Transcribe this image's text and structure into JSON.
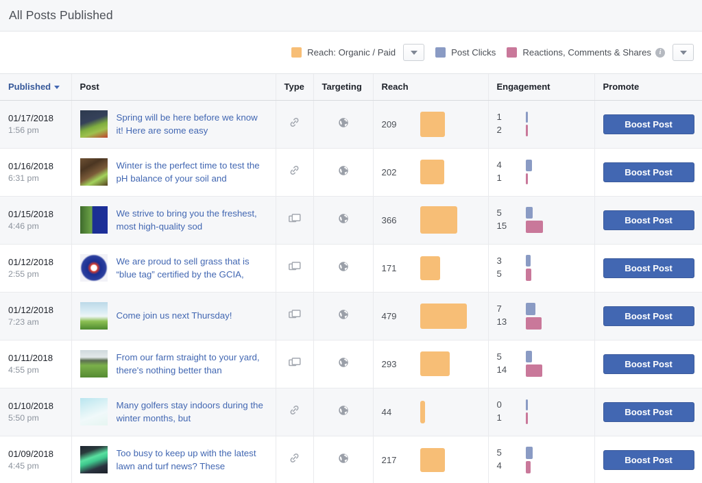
{
  "header": {
    "title": "All Posts Published"
  },
  "legend": {
    "items": [
      {
        "label": "Reach: Organic / Paid",
        "color": "#f7be76",
        "icon": "square-swatch"
      },
      {
        "label": "Post Clicks",
        "color": "#8a9bc4",
        "icon": "square-swatch"
      },
      {
        "label": "Reactions, Comments & Shares",
        "color": "#c9789a",
        "icon": "square-swatch"
      }
    ],
    "info_icon": "info-icon",
    "dropdown_icon": "chevron-down-icon",
    "dropdown_1_label": "",
    "dropdown_2_label": ""
  },
  "table": {
    "columns": [
      {
        "key": "published",
        "label": "Published",
        "sorted": true,
        "sort_dir": "desc"
      },
      {
        "key": "post",
        "label": "Post"
      },
      {
        "key": "type",
        "label": "Type"
      },
      {
        "key": "targeting",
        "label": "Targeting"
      },
      {
        "key": "reach",
        "label": "Reach"
      },
      {
        "key": "engagement",
        "label": "Engagement"
      },
      {
        "key": "promote",
        "label": "Promote"
      }
    ],
    "promote_button_label": "Boost Post",
    "rows": [
      {
        "date": "01/17/2018",
        "time": "1:56 pm",
        "text": "Spring will be here before we know it! Here are some easy",
        "type_icon": "link-icon",
        "targeting_icon": "globe-icon",
        "reach": 209,
        "reach_bar_w": 36,
        "reach_bar_h": 37,
        "clicks": 1,
        "reactions": 2,
        "clicks_bar_w": 3,
        "clicks_bar_h": 16,
        "react_bar_w": 3,
        "react_bar_h": 17,
        "thumb": "thumb-spring"
      },
      {
        "date": "01/16/2018",
        "time": "6:31 pm",
        "text": "Winter is the perfect time to test the pH balance of your soil and",
        "type_icon": "link-icon",
        "targeting_icon": "globe-icon",
        "reach": 202,
        "reach_bar_w": 35,
        "reach_bar_h": 36,
        "clicks": 4,
        "reactions": 1,
        "clicks_bar_w": 9,
        "clicks_bar_h": 17,
        "react_bar_w": 3,
        "react_bar_h": 16,
        "thumb": "thumb-soil"
      },
      {
        "date": "01/15/2018",
        "time": "4:46 pm",
        "text": "We strive to bring you the freshest, most high-quality sod",
        "type_icon": "photos-icon",
        "targeting_icon": "globe-icon",
        "reach": 366,
        "reach_bar_w": 54,
        "reach_bar_h": 40,
        "clicks": 5,
        "reactions": 15,
        "clicks_bar_w": 10,
        "clicks_bar_h": 17,
        "react_bar_w": 25,
        "react_bar_h": 18,
        "thumb": "thumb-sod"
      },
      {
        "date": "01/12/2018",
        "time": "2:55 pm",
        "text": "We are proud to sell grass that is “blue tag” certified by the GCIA,",
        "type_icon": "photos-icon",
        "targeting_icon": "globe-icon",
        "reach": 171,
        "reach_bar_w": 29,
        "reach_bar_h": 35,
        "clicks": 3,
        "reactions": 5,
        "clicks_bar_w": 7,
        "clicks_bar_h": 17,
        "react_bar_w": 8,
        "react_bar_h": 18,
        "thumb": "thumb-gcia"
      },
      {
        "date": "01/12/2018",
        "time": "7:23 am",
        "text": "Come join us next Thursday!",
        "type_icon": "photos-icon",
        "targeting_icon": "globe-icon",
        "reach": 479,
        "reach_bar_w": 68,
        "reach_bar_h": 37,
        "clicks": 7,
        "reactions": 13,
        "clicks_bar_w": 14,
        "clicks_bar_h": 18,
        "react_bar_w": 23,
        "react_bar_h": 18,
        "thumb": "thumb-event"
      },
      {
        "date": "01/11/2018",
        "time": "4:55 pm",
        "text": "From our farm straight to your yard, there's nothing better than",
        "type_icon": "photos-icon",
        "targeting_icon": "globe-icon",
        "reach": 293,
        "reach_bar_w": 43,
        "reach_bar_h": 36,
        "clicks": 5,
        "reactions": 14,
        "clicks_bar_w": 9,
        "clicks_bar_h": 17,
        "react_bar_w": 24,
        "react_bar_h": 18,
        "thumb": "thumb-farm"
      },
      {
        "date": "01/10/2018",
        "time": "5:50 pm",
        "text": "Many golfers stay indoors during the winter months, but",
        "type_icon": "link-icon",
        "targeting_icon": "globe-icon",
        "reach": 44,
        "reach_bar_w": 7,
        "reach_bar_h": 33,
        "clicks": 0,
        "reactions": 1,
        "clicks_bar_w": 3,
        "clicks_bar_h": 16,
        "react_bar_w": 3,
        "react_bar_h": 17,
        "thumb": "thumb-sky"
      },
      {
        "date": "01/09/2018",
        "time": "4:45 pm",
        "text": "Too busy to keep up with the latest lawn and turf news? These",
        "type_icon": "link-icon",
        "targeting_icon": "globe-icon",
        "reach": 217,
        "reach_bar_w": 36,
        "reach_bar_h": 35,
        "clicks": 5,
        "reactions": 4,
        "clicks_bar_w": 10,
        "clicks_bar_h": 18,
        "react_bar_w": 7,
        "react_bar_h": 18,
        "thumb": "thumb-aurora"
      }
    ]
  }
}
